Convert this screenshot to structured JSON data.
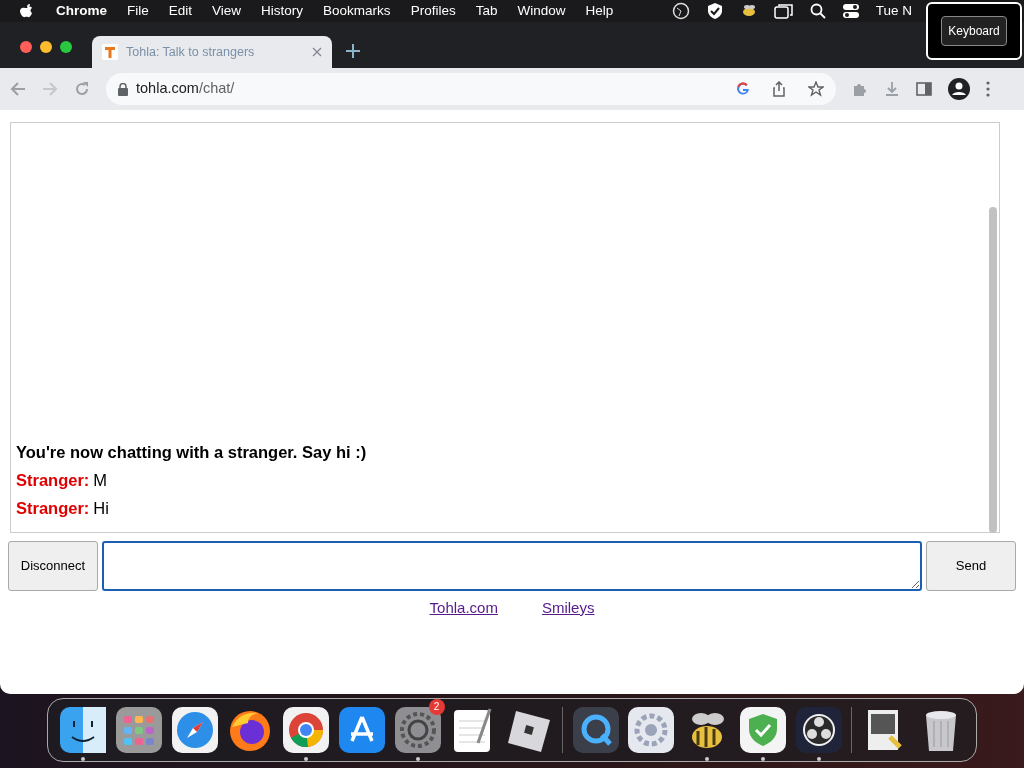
{
  "menubar": {
    "app": "Chrome",
    "menus": [
      "File",
      "Edit",
      "View",
      "History",
      "Bookmarks",
      "Profiles",
      "Tab",
      "Window",
      "Help"
    ],
    "clock": "Tue N"
  },
  "keyboard_popup": {
    "label": "Keyboard"
  },
  "tab": {
    "title": "Tohla: Talk to strangers",
    "selected": true
  },
  "address": {
    "host": "tohla.com",
    "path": "/chat/"
  },
  "chat": {
    "messages": [
      {
        "kind": "system",
        "text": "You're now chatting with a stranger. Say hi :)"
      },
      {
        "kind": "stranger",
        "sender": "Stranger:",
        "text": "M"
      },
      {
        "kind": "stranger",
        "sender": "Stranger:",
        "text": "Hi"
      }
    ]
  },
  "input": {
    "disconnect": "Disconnect",
    "send": "Send"
  },
  "links": [
    "Tohla.com",
    "Smileys"
  ],
  "dock": {
    "items": [
      {
        "kind": "finder",
        "running": true
      },
      {
        "kind": "launchpad",
        "running": false
      },
      {
        "kind": "safari",
        "running": false
      },
      {
        "kind": "firefox",
        "running": false
      },
      {
        "kind": "chrome",
        "running": true
      },
      {
        "kind": "appstore",
        "running": false
      },
      {
        "kind": "settings",
        "running": true,
        "badge": "2"
      },
      {
        "kind": "textedit",
        "running": false
      },
      {
        "kind": "roblox",
        "running": false
      },
      {
        "kind": "separator"
      },
      {
        "kind": "quicktime",
        "running": false
      },
      {
        "kind": "gear",
        "running": false
      },
      {
        "kind": "bee",
        "running": true
      },
      {
        "kind": "shield",
        "running": true
      },
      {
        "kind": "obs",
        "running": true
      },
      {
        "kind": "separator"
      },
      {
        "kind": "preview",
        "running": false
      },
      {
        "kind": "trash",
        "running": false
      }
    ]
  }
}
